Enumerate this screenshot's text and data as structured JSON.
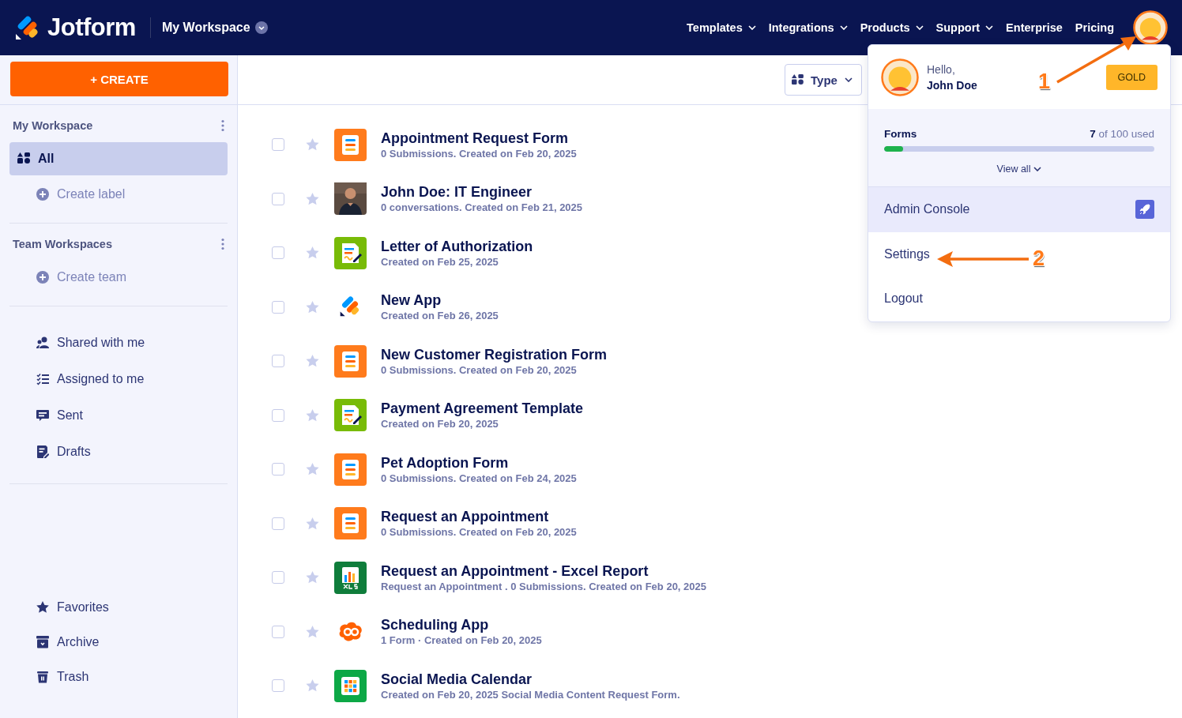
{
  "header": {
    "brand": "Jotform",
    "workspace": "My Workspace",
    "nav": [
      {
        "label": "Templates",
        "dropdown": true
      },
      {
        "label": "Integrations",
        "dropdown": true
      },
      {
        "label": "Products",
        "dropdown": true
      },
      {
        "label": "Support",
        "dropdown": true
      },
      {
        "label": "Enterprise",
        "dropdown": false
      },
      {
        "label": "Pricing",
        "dropdown": false
      }
    ]
  },
  "sidebar": {
    "create_button": "+ CREATE",
    "groups": [
      {
        "heading": "My Workspace",
        "items": [
          {
            "label": "All",
            "kind": "all",
            "selected": true
          },
          {
            "label": "Create label",
            "kind": "add",
            "selected": false
          }
        ]
      },
      {
        "heading": "Team Workspaces",
        "items": [
          {
            "label": "Create team",
            "kind": "add",
            "selected": false
          }
        ]
      },
      {
        "items": [
          {
            "label": "Shared with me",
            "kind": "shared",
            "selected": false
          },
          {
            "label": "Assigned to me",
            "kind": "assigned",
            "selected": false
          },
          {
            "label": "Sent",
            "kind": "sent",
            "selected": false
          },
          {
            "label": "Drafts",
            "kind": "drafts",
            "selected": false
          }
        ]
      },
      {
        "items": [
          {
            "label": "Favorites",
            "kind": "favorites",
            "selected": false
          },
          {
            "label": "Archive",
            "kind": "archive",
            "selected": false
          },
          {
            "label": "Trash",
            "kind": "trash",
            "selected": false
          }
        ]
      }
    ]
  },
  "toolbar": {
    "type_filter": "Type"
  },
  "items": [
    {
      "title": "Appointment Request Form",
      "subtitle": "0 Submissions. Created on Feb 20, 2025",
      "kind": "form",
      "checked": false,
      "starred": false
    },
    {
      "title": "John Doe: IT Engineer",
      "subtitle": "0 conversations. Created on Feb 21, 2025",
      "kind": "picture",
      "checked": false,
      "starred": false
    },
    {
      "title": "Letter of Authorization",
      "subtitle": "Created on Feb 25, 2025",
      "kind": "sign",
      "checked": false,
      "starred": false
    },
    {
      "title": "New App",
      "subtitle": "Created on Feb 26, 2025",
      "kind": "app",
      "checked": false,
      "starred": false
    },
    {
      "title": "New Customer Registration Form",
      "subtitle": "0 Submissions. Created on Feb 20, 2025",
      "kind": "form",
      "checked": false,
      "starred": false
    },
    {
      "title": "Payment Agreement Template",
      "subtitle": "Created on Feb 20, 2025",
      "kind": "sign",
      "checked": false,
      "starred": false
    },
    {
      "title": "Pet Adoption Form",
      "subtitle": "0 Submissions. Created on Feb 24, 2025",
      "kind": "form",
      "checked": false,
      "starred": false
    },
    {
      "title": "Request an Appointment",
      "subtitle": "0 Submissions. Created on Feb 20, 2025",
      "kind": "form",
      "checked": false,
      "starred": false
    },
    {
      "title": "Request an Appointment - Excel Report",
      "subtitle": "Request an Appointment . 0 Submissions. Created on Feb 20, 2025",
      "kind": "report",
      "checked": false,
      "starred": false
    },
    {
      "title": "Scheduling App",
      "subtitle": "1 Form · Created on Feb 20, 2025",
      "kind": "go",
      "checked": false,
      "starred": false
    },
    {
      "title": "Social Media Calendar",
      "subtitle": "Created on Feb 20, 2025 Social Media Content Request Form.",
      "kind": "calendar",
      "checked": false,
      "starred": false
    }
  ],
  "account_menu": {
    "greeting": "Hello,",
    "name": "John Doe",
    "plan": "GOLD",
    "usage_label": "Forms",
    "usage_count": "7",
    "usage_text": "of 100 used",
    "level": 0.07,
    "view_all": "View all",
    "items": [
      {
        "label": "Admin Console",
        "kind": "admin",
        "highlighted": true
      },
      {
        "label": "Settings",
        "kind": "plain",
        "highlighted": false
      },
      {
        "label": "Logout",
        "kind": "plain",
        "highlighted": false
      }
    ]
  },
  "annotations": [
    {
      "label": "1",
      "kind": "to-avatar"
    },
    {
      "label": "2",
      "kind": "to-settings"
    }
  ]
}
